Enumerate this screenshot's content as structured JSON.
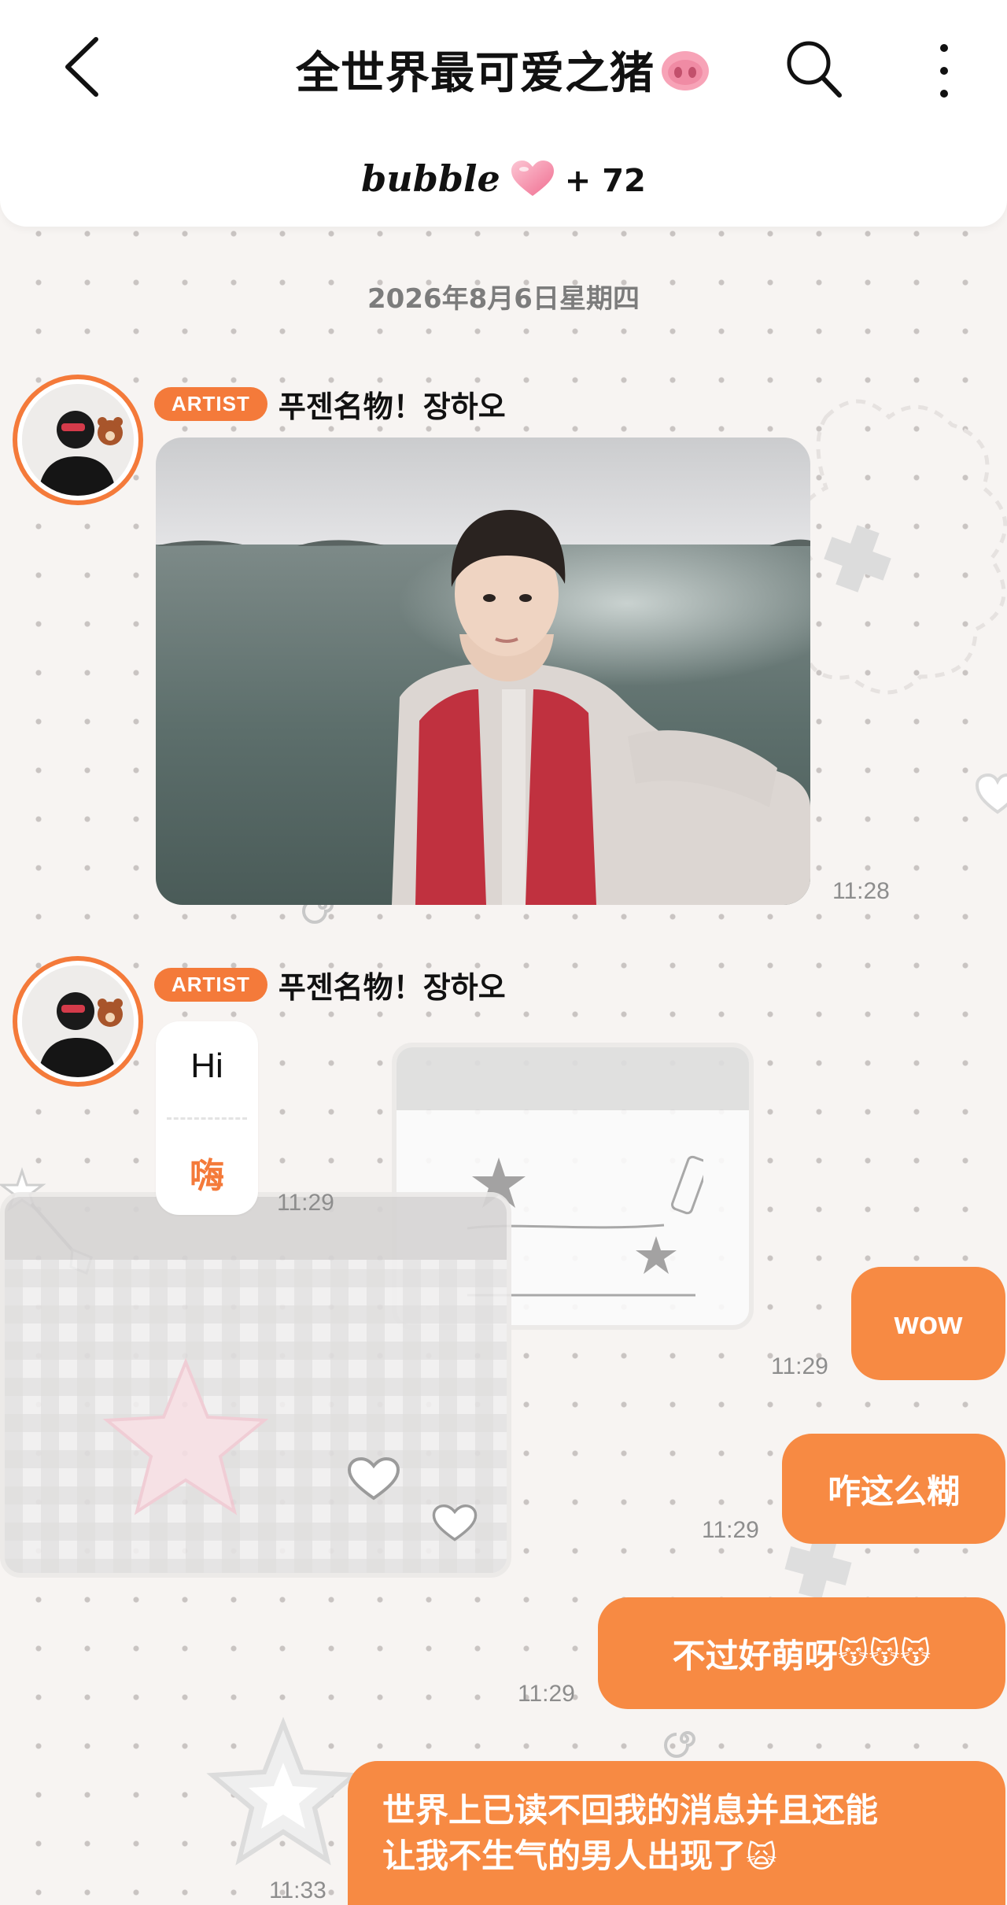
{
  "header": {
    "title": "全世界最可爱之猪",
    "title_emoji_icon": "pig-nose-icon",
    "back_icon": "chevron-left-icon",
    "search_icon": "search-icon",
    "more_icon": "more-vertical-icon",
    "bubble_logo": "bubble",
    "bubble_heart_icon": "heart-icon",
    "bubble_count": "+ 72"
  },
  "date_separator": "2026年8月6日星期四",
  "messages": [
    {
      "type": "photo",
      "sender_badge": "ARTIST",
      "sender_name": "푸젠名物！장하오",
      "time": "11:28"
    },
    {
      "type": "text",
      "sender_badge": "ARTIST",
      "sender_name": "푸젠名物！장하오",
      "original": "Hi",
      "translation": "嗨",
      "time": "11:29"
    }
  ],
  "outgoing": [
    {
      "text": "wow",
      "time": "11:29"
    },
    {
      "text": "咋这么糊",
      "time": "11:29"
    },
    {
      "text": "不过好萌呀",
      "emoji": "😽😽😽",
      "time": "11:29"
    },
    {
      "line1": "世界上已读不回我的消息并且还能",
      "line2": "让我不生气的男人出现了",
      "emoji": "🙀",
      "time": "11:33"
    }
  ],
  "colors": {
    "accent": "#f47a3a",
    "bubble": "#f78a43",
    "background": "#f7f4f2"
  }
}
